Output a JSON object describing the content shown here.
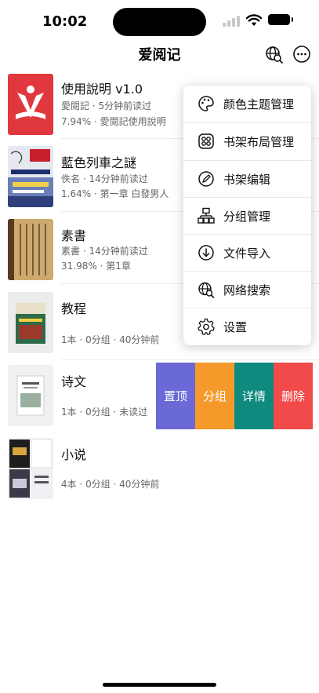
{
  "status_bar": {
    "time": "10:02"
  },
  "nav": {
    "title": "爱阅记",
    "search_icon": "web-search-icon",
    "more_icon": "more-icon"
  },
  "books": [
    {
      "title": "使用說明 v1.0",
      "line1": "愛閱記 · 5分钟前读过",
      "line2": "7.94% · 愛閱記使用說明"
    },
    {
      "title": "藍色列車之謎",
      "line1": "佚名 · 14分钟前读过",
      "line2": "1.64% · 第一章 白發男人"
    },
    {
      "title": "素書",
      "line1": "素書 · 14分钟前读过",
      "line2": "31.98% · 第1章"
    }
  ],
  "groups": [
    {
      "title": "教程",
      "meta": "1本 · 0分组 · 40分钟前"
    },
    {
      "title": "诗文",
      "meta": "1本 · 0分组 · 未读过"
    },
    {
      "title": "小说",
      "meta": "4本 · 0分组 · 40分钟前"
    }
  ],
  "swipe_actions": [
    {
      "label": "置顶",
      "color": "#6b69d6"
    },
    {
      "label": "分组",
      "color": "#f59a2a"
    },
    {
      "label": "详情",
      "color": "#0e8a7e"
    },
    {
      "label": "删除",
      "color": "#f24a4a"
    }
  ],
  "menu": {
    "items": [
      {
        "label": "颜色主题管理",
        "icon": "palette-icon"
      },
      {
        "label": "书架布局管理",
        "icon": "layout-grid-icon"
      },
      {
        "label": "书架编辑",
        "icon": "edit-icon"
      },
      {
        "label": "分组管理",
        "icon": "hierarchy-icon"
      },
      {
        "label": "文件导入",
        "icon": "download-icon"
      },
      {
        "label": "网络搜索",
        "icon": "web-search-icon"
      },
      {
        "label": "设置",
        "icon": "gear-icon"
      }
    ]
  },
  "colors": {
    "accent_red": "#e8343a",
    "text_secondary": "#666666"
  }
}
